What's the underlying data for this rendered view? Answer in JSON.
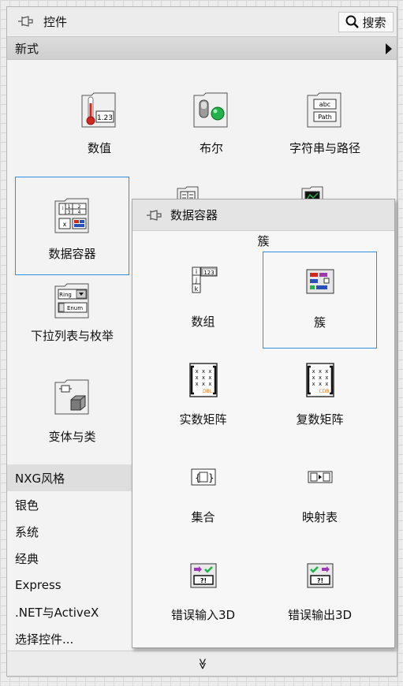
{
  "palette": {
    "title": "控件",
    "search_label": "搜索",
    "category": "新式",
    "tiles": [
      {
        "label": "数值",
        "icon": "numeric-icon"
      },
      {
        "label": "布尔",
        "icon": "boolean-icon"
      },
      {
        "label": "字符串与路径",
        "icon": "string-path-icon"
      },
      {
        "label": "数据容器",
        "icon": "data-container-icon"
      },
      {
        "label": "下拉列表与枚举",
        "icon": "ring-enum-icon"
      },
      {
        "label": "变体与类",
        "icon": "variant-class-icon"
      }
    ],
    "categories": [
      "NXG风格",
      "银色",
      "系统",
      "经典",
      "Express",
      ".NET与ActiveX",
      "选择控件..."
    ],
    "expand_glyph": "≫"
  },
  "subpalette": {
    "title": "数据容器",
    "section": "簇",
    "tiles": [
      {
        "label": "数组",
        "icon": "array-icon"
      },
      {
        "label": "簇",
        "icon": "cluster-icon"
      },
      {
        "label": "实数矩阵",
        "icon": "real-matrix-icon"
      },
      {
        "label": "复数矩阵",
        "icon": "complex-matrix-icon"
      },
      {
        "label": "集合",
        "icon": "set-icon"
      },
      {
        "label": "映射表",
        "icon": "map-icon"
      },
      {
        "label": "错误输入3D",
        "icon": "error-in-icon"
      },
      {
        "label": "错误输出3D",
        "icon": "error-out-icon"
      }
    ]
  },
  "icon_text": {
    "numeric": "1.23",
    "string1": "abc",
    "string2": "Path",
    "cluster_nums": [
      "1",
      "2",
      "3",
      "4"
    ],
    "ring": "Ring",
    "enum": "Enum",
    "array_idx": [
      "i",
      "j",
      "k"
    ],
    "array_val": "123",
    "matrix_cell": "x",
    "real_tag": "DBL",
    "complex_tag": "CDB",
    "error_q": "?!"
  },
  "colors": {
    "selection": "#2f8fdc",
    "accent_green": "#22b14c"
  }
}
